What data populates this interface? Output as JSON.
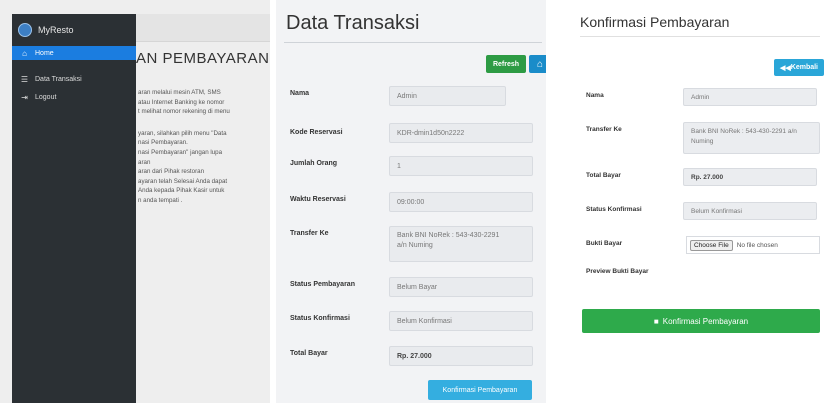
{
  "panel1": {
    "brand": "MyResto",
    "menu": [
      {
        "label": "Home",
        "icon": "home-icon",
        "active": true
      },
      {
        "label": "Data Transaksi",
        "icon": "table-icon",
        "active": false
      },
      {
        "label": "Logout",
        "icon": "logout-icon",
        "active": false
      }
    ],
    "heading": "AN PEMBAYARAN",
    "lines": [
      "aran melalui mesin ATM, SMS",
      "atau Internet Banking ke nomor",
      "t melihat nomor rekening di menu",
      "",
      "yaran, silahkan pilih menu \"Data",
      "nasi Pembayaran.",
      "nasi Pembayaran\" jangan lupa",
      "aran",
      "aran dari Pihak restoran",
      "ayaran telah Selesai Anda dapat",
      "Anda kepada Pihak Kasir untuk",
      "n anda tempati ."
    ]
  },
  "panel2": {
    "title": "Data Transaksi",
    "refresh_label": "Refresh",
    "home_icon": "home-icon",
    "fields": {
      "nama": {
        "label": "Nama",
        "value": "Admin"
      },
      "kode": {
        "label": "Kode Reservasi",
        "value": "KDR-dmin1d50n2222"
      },
      "jumlah": {
        "label": "Jumlah Orang",
        "value": "1"
      },
      "waktu": {
        "label": "Waktu Reservasi",
        "value": "09:00:00"
      },
      "transfer": {
        "label": "Transfer Ke",
        "value_line1": "Bank BNI NoRek : 543-430-2291",
        "value_line2": "a/n Numing"
      },
      "status_bayar": {
        "label": "Status Pembayaran",
        "value": "Belum Bayar"
      },
      "status_konf": {
        "label": "Status Konfirmasi",
        "value": "Belum Konfirmasi"
      },
      "total": {
        "label": "Total Bayar",
        "value": "Rp. 27.000"
      }
    },
    "konfirmasi_label": "Konfirmasi Pembayaran"
  },
  "panel3": {
    "title": "Konfirmasi Pembayaran",
    "kembali_label": "Kembali",
    "fields": {
      "nama": {
        "label": "Nama",
        "value": "Admin"
      },
      "transfer": {
        "label": "Transfer Ke",
        "value_line1": "Bank BNI NoRek : 543-430-2291 a/n",
        "value_line2": "Numing"
      },
      "total": {
        "label": "Total Bayar",
        "value": "Rp. 27.000"
      },
      "status_konf": {
        "label": "Status Konfirmasi",
        "value": "Belum Konfirmasi"
      },
      "bukti": {
        "label": "Bukti Bayar",
        "choose": "Choose File",
        "nofile": "No file chosen"
      },
      "preview": {
        "label": "Preview Bukti Bayar"
      }
    },
    "konfirmasi_label": "Konfirmasi Pembayaran"
  }
}
